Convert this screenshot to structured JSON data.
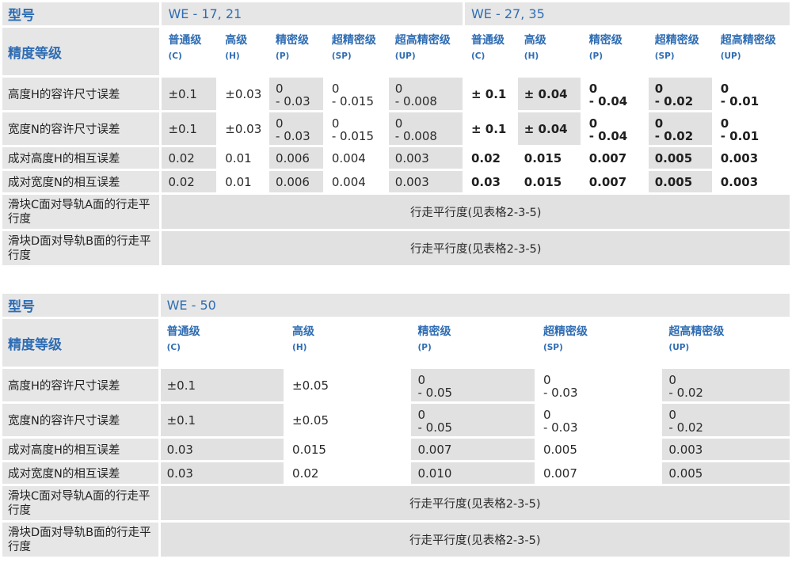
{
  "table1": {
    "model_label": "型号",
    "model_a": "WE - 17, 21",
    "model_b": "WE - 27, 35",
    "grade_label": "精度等级",
    "grades": [
      {
        "name": "普通级",
        "code": "(C)"
      },
      {
        "name": "高级",
        "code": "(H)"
      },
      {
        "name": "精密级",
        "code": "(P)"
      },
      {
        "name": "超精密级",
        "code": "(SP)"
      },
      {
        "name": "超高精密级",
        "code": "(UP)"
      }
    ],
    "rows": [
      {
        "label": "高度H的容许尺寸误差",
        "a": [
          [
            "±0.1"
          ],
          [
            "±0.03"
          ],
          [
            "0",
            "- 0.03"
          ],
          [
            "0",
            "- 0.015"
          ],
          [
            "0",
            "- 0.008"
          ]
        ],
        "b": [
          [
            "± 0.1"
          ],
          [
            "± 0.04"
          ],
          [
            "0",
            "- 0.04"
          ],
          [
            "0",
            "- 0.02"
          ],
          [
            "0",
            "- 0.01"
          ]
        ]
      },
      {
        "label": "宽度N的容许尺寸误差",
        "a": [
          [
            "±0.1"
          ],
          [
            "±0.03"
          ],
          [
            "0",
            "- 0.03"
          ],
          [
            "0",
            "- 0.015"
          ],
          [
            "0",
            "- 0.008"
          ]
        ],
        "b": [
          [
            "± 0.1"
          ],
          [
            "± 0.04"
          ],
          [
            "0",
            "- 0.04"
          ],
          [
            "0",
            "- 0.02"
          ],
          [
            "0",
            "- 0.01"
          ]
        ]
      },
      {
        "label": "成对高度H的相互误差",
        "a": [
          [
            "0.02"
          ],
          [
            "0.01"
          ],
          [
            "0.006"
          ],
          [
            "0.004"
          ],
          [
            "0.003"
          ]
        ],
        "b": [
          [
            "0.02"
          ],
          [
            "0.015"
          ],
          [
            "0.007"
          ],
          [
            "0.005"
          ],
          [
            "0.003"
          ]
        ]
      },
      {
        "label": "成对宽度N的相互误差",
        "a": [
          [
            "0.02"
          ],
          [
            "0.01"
          ],
          [
            "0.006"
          ],
          [
            "0.004"
          ],
          [
            "0.003"
          ]
        ],
        "b": [
          [
            "0.03"
          ],
          [
            "0.015"
          ],
          [
            "0.007"
          ],
          [
            "0.005"
          ],
          [
            "0.003"
          ]
        ]
      }
    ],
    "parallel_c_label": "滑块C面对导轨A面的行走平行度",
    "parallel_d_label": "滑块D面对导轨B面的行走平行度",
    "parallel_note": "行走平行度(见表格2-3-5)"
  },
  "table2": {
    "model_label": "型号",
    "model": "WE - 50",
    "grade_label": "精度等级",
    "grades": [
      {
        "name": "普通级",
        "code": "(C)"
      },
      {
        "name": "高级",
        "code": "(H)"
      },
      {
        "name": "精密级",
        "code": "(P)"
      },
      {
        "name": "超精密级",
        "code": "(SP)"
      },
      {
        "name": "超高精密级",
        "code": "(UP)"
      }
    ],
    "rows": [
      {
        "label": "高度H的容许尺寸误差",
        "v": [
          [
            "±0.1"
          ],
          [
            "±0.05"
          ],
          [
            "0",
            "- 0.05"
          ],
          [
            "0",
            "- 0.03"
          ],
          [
            "0",
            "- 0.02"
          ]
        ]
      },
      {
        "label": "宽度N的容许尺寸误差",
        "v": [
          [
            "±0.1"
          ],
          [
            "±0.05"
          ],
          [
            "0",
            "- 0.05"
          ],
          [
            "0",
            "- 0.03"
          ],
          [
            "0",
            "- 0.02"
          ]
        ]
      },
      {
        "label": "成对高度H的相互误差",
        "v": [
          [
            "0.03"
          ],
          [
            "0.015"
          ],
          [
            "0.007"
          ],
          [
            "0.005"
          ],
          [
            "0.003"
          ]
        ]
      },
      {
        "label": "成对宽度N的相互误差",
        "v": [
          [
            "0.03"
          ],
          [
            "0.02"
          ],
          [
            "0.010"
          ],
          [
            "0.007"
          ],
          [
            "0.005"
          ]
        ]
      }
    ],
    "parallel_c_label": "滑块C面对导轨A面的行走平行度",
    "parallel_d_label": "滑块D面对导轨B面的行走平行度",
    "parallel_note": "行走平行度(见表格2-3-5)"
  }
}
